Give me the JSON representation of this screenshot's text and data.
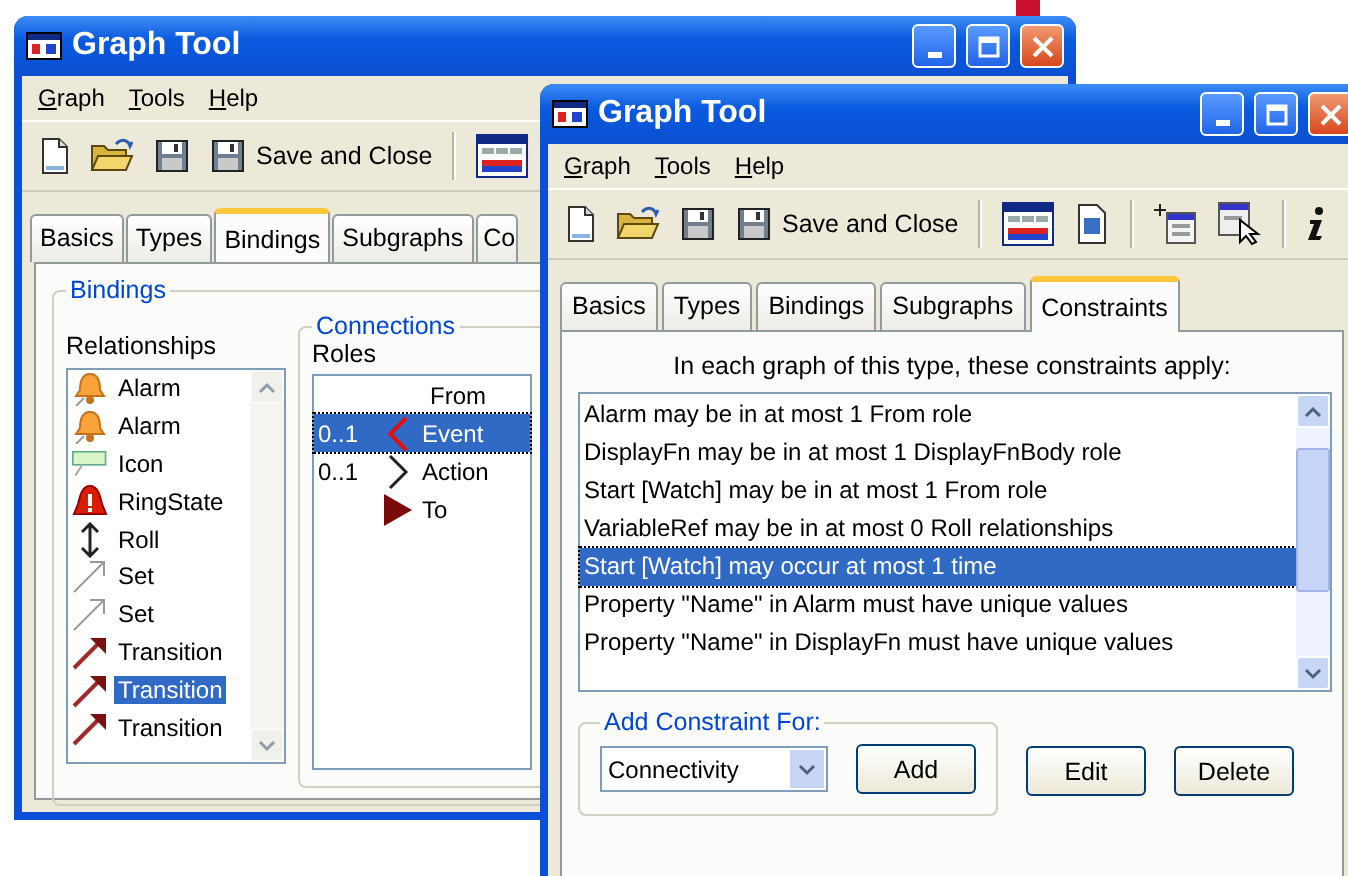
{
  "back_window": {
    "title": "Graph Tool",
    "menu": [
      "Graph",
      "Tools",
      "Help"
    ],
    "toolbar": [
      {
        "kind": "new"
      },
      {
        "kind": "open"
      },
      {
        "kind": "save"
      },
      {
        "kind": "save-close",
        "label": "Save and Close"
      },
      {
        "kind": "separator"
      },
      {
        "kind": "merl"
      }
    ],
    "tabs": [
      {
        "label": "Basics",
        "selected": false
      },
      {
        "label": "Types",
        "selected": false
      },
      {
        "label": "Bindings",
        "selected": true
      },
      {
        "label": "Subgraphs",
        "selected": false
      },
      {
        "label": "Co",
        "selected": false
      }
    ],
    "group_title": "Bindings",
    "relationships_label": "Relationships",
    "relationships": [
      {
        "kind": "bell",
        "label": "Alarm",
        "selected": false
      },
      {
        "kind": "bell",
        "label": "Alarm",
        "selected": false
      },
      {
        "kind": "tag",
        "label": "Icon",
        "selected": false
      },
      {
        "kind": "alert",
        "label": "RingState",
        "selected": false
      },
      {
        "kind": "updown",
        "label": "Roll",
        "selected": false
      },
      {
        "kind": "link",
        "label": "Set",
        "selected": false
      },
      {
        "kind": "link",
        "label": "Set",
        "selected": false
      },
      {
        "kind": "transition",
        "label": "Transition",
        "selected": false
      },
      {
        "kind": "transition",
        "label": "Transition",
        "selected": true
      },
      {
        "kind": "transition",
        "label": "Transition",
        "selected": false
      }
    ],
    "connections_title": "Connections",
    "roles_label": "Roles",
    "roles_header": "From",
    "roles": [
      {
        "multiplicity": "0..1",
        "kind": "open-left",
        "name": "Event",
        "selected": true
      },
      {
        "multiplicity": "0..1",
        "kind": "open-right",
        "name": "Action",
        "selected": false
      },
      {
        "kind": "solid-right",
        "name": "To",
        "selected": false
      }
    ]
  },
  "front_window": {
    "title": "Graph Tool",
    "menu": [
      "Graph",
      "Tools",
      "Help"
    ],
    "toolbar": [
      {
        "kind": "new"
      },
      {
        "kind": "open"
      },
      {
        "kind": "save"
      },
      {
        "kind": "save-close",
        "label": "Save and Close"
      },
      {
        "kind": "separator"
      },
      {
        "kind": "merl"
      },
      {
        "kind": "doc"
      },
      {
        "kind": "separator"
      },
      {
        "kind": "form-new"
      },
      {
        "kind": "form-pointer"
      },
      {
        "kind": "separator"
      },
      {
        "kind": "info"
      }
    ],
    "tabs": [
      {
        "label": "Basics",
        "selected": false
      },
      {
        "label": "Types",
        "selected": false
      },
      {
        "label": "Bindings",
        "selected": false
      },
      {
        "label": "Subgraphs",
        "selected": false
      },
      {
        "label": "Constraints",
        "selected": true
      }
    ],
    "caption": "In each graph of this type, these constraints apply:",
    "constraints": [
      {
        "text": "Alarm may be in at most 1 From role",
        "selected": false
      },
      {
        "text": "DisplayFn may be in at most 1 DisplayFnBody role",
        "selected": false
      },
      {
        "text": "Start [Watch] may be in at most 1 From role",
        "selected": false
      },
      {
        "text": "VariableRef may be in at most 0 Roll relationships",
        "selected": false
      },
      {
        "text": "Start [Watch] may occur at most 1 time",
        "selected": true
      },
      {
        "text": "Property \"Name\" in Alarm must have unique values",
        "selected": false
      },
      {
        "text": "Property \"Name\" in DisplayFn must have unique values",
        "selected": false
      }
    ],
    "add_group_title": "Add Constraint For:",
    "constraint_type": "Connectivity",
    "buttons": [
      "Add",
      "Edit",
      "Delete"
    ]
  }
}
